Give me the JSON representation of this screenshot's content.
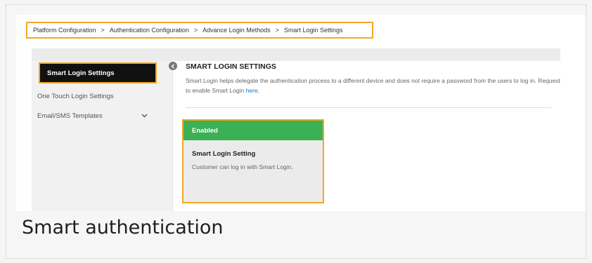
{
  "breadcrumb": {
    "items": [
      "Platform Configuration",
      "Authentication Configuration",
      "Advance Login Methods",
      "Smart Login Settings"
    ],
    "separator": ">"
  },
  "sidebar": {
    "items": [
      {
        "label": "Smart Login Settings",
        "active": true
      },
      {
        "label": "One Touch Login Settings",
        "active": false
      },
      {
        "label": "Email/SMS Templates",
        "active": false,
        "expandable": true
      }
    ]
  },
  "content": {
    "title": "SMART LOGIN SETTINGS",
    "description": "Smart Login helps delegate the authentication process to a different device and does not require a password from the users to log in. Request to enable Smart Login",
    "link_text": "here",
    "description_end": "."
  },
  "card": {
    "status": "Enabled",
    "title": "Smart Login Setting",
    "description": "Customer can log in with Smart Login."
  },
  "caption": "Smart authentication",
  "colors": {
    "highlight": "#f5a623",
    "enabled": "#3cb054",
    "link": "#1a73c8",
    "active_bg": "#111111"
  },
  "icons": {
    "collapse": "chevron-left-icon",
    "expand": "chevron-down-icon"
  }
}
